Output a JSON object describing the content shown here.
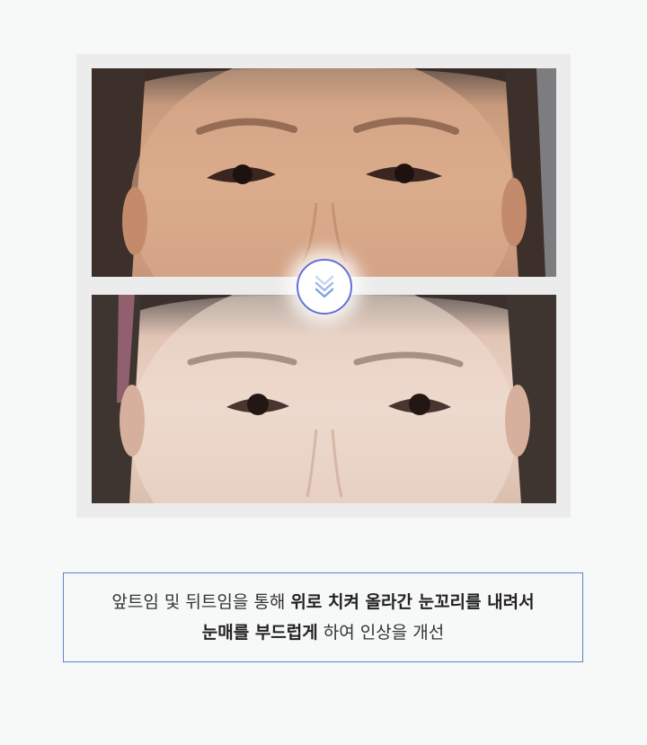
{
  "caption": {
    "line1_normal": "앞트임 및 뒤트임을 통해 ",
    "line1_bold": "위로 치켜 올라간 눈꼬리를 내려서",
    "line2_bold": "눈매를 부드럽게",
    "line2_normal": " 하여 인상을 개선"
  },
  "icons": {
    "transition": "double-chevron-down-icon"
  },
  "colors": {
    "accent_border": "#5a86c8",
    "badge_border": "#6470d8",
    "chevron": "#7aa8e0"
  }
}
